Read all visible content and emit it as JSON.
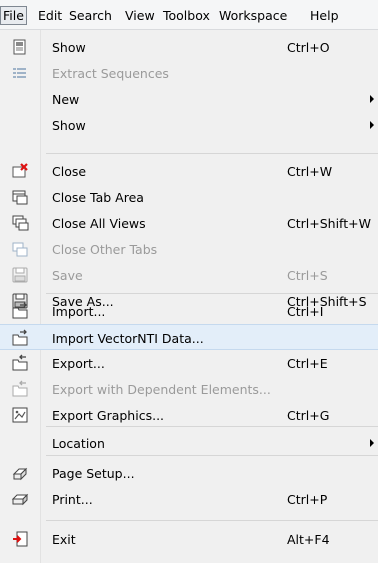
{
  "menubar": {
    "file": "File",
    "edit": "Edit",
    "search": "Search",
    "view": "View",
    "toolbox": "Toolbox",
    "workspace": "Workspace",
    "help": "Help"
  },
  "menu": {
    "items": [
      {
        "label": "Show",
        "shortcut": "Ctrl+O",
        "icon": "show-icon",
        "enabled": true
      },
      {
        "label": "Extract Sequences",
        "shortcut": "",
        "icon": "extract-sequences-icon",
        "enabled": false
      },
      {
        "label": "New",
        "shortcut": "",
        "icon": "",
        "enabled": true,
        "submenu": true
      },
      {
        "label": "Show",
        "shortcut": "",
        "icon": "",
        "enabled": true,
        "submenu": true
      },
      {
        "label": "Close",
        "shortcut": "Ctrl+W",
        "icon": "close-icon",
        "enabled": true
      },
      {
        "label": "Close Tab Area",
        "shortcut": "",
        "icon": "close-tab-area-icon",
        "enabled": true
      },
      {
        "label": "Close All Views",
        "shortcut": "Ctrl+Shift+W",
        "icon": "close-all-views-icon",
        "enabled": true
      },
      {
        "label": "Close Other Tabs",
        "shortcut": "",
        "icon": "close-other-tabs-icon",
        "enabled": false
      },
      {
        "label": "Save",
        "shortcut": "Ctrl+S",
        "icon": "save-icon",
        "enabled": false
      },
      {
        "label": "Save As...",
        "shortcut": "Ctrl+Shift+S",
        "icon": "save-as-icon",
        "enabled": true
      },
      {
        "label": "Import...",
        "shortcut": "Ctrl+I",
        "icon": "import-icon",
        "enabled": true
      },
      {
        "label": "Import VectorNTI Data...",
        "shortcut": "",
        "icon": "import-vectornti-icon",
        "enabled": true,
        "highlighted": true
      },
      {
        "label": "Export...",
        "shortcut": "Ctrl+E",
        "icon": "export-icon",
        "enabled": true
      },
      {
        "label": "Export with Dependent Elements...",
        "shortcut": "",
        "icon": "export-dependent-icon",
        "enabled": false
      },
      {
        "label": "Export Graphics...",
        "shortcut": "Ctrl+G",
        "icon": "export-graphics-icon",
        "enabled": true
      },
      {
        "label": "Location",
        "shortcut": "",
        "icon": "",
        "enabled": true,
        "submenu": true
      },
      {
        "label": "Page Setup...",
        "shortcut": "",
        "icon": "page-setup-icon",
        "enabled": true
      },
      {
        "label": "Print...",
        "shortcut": "Ctrl+P",
        "icon": "print-icon",
        "enabled": true
      },
      {
        "label": "Exit",
        "shortcut": "Alt+F4",
        "icon": "exit-icon",
        "enabled": true
      }
    ]
  }
}
